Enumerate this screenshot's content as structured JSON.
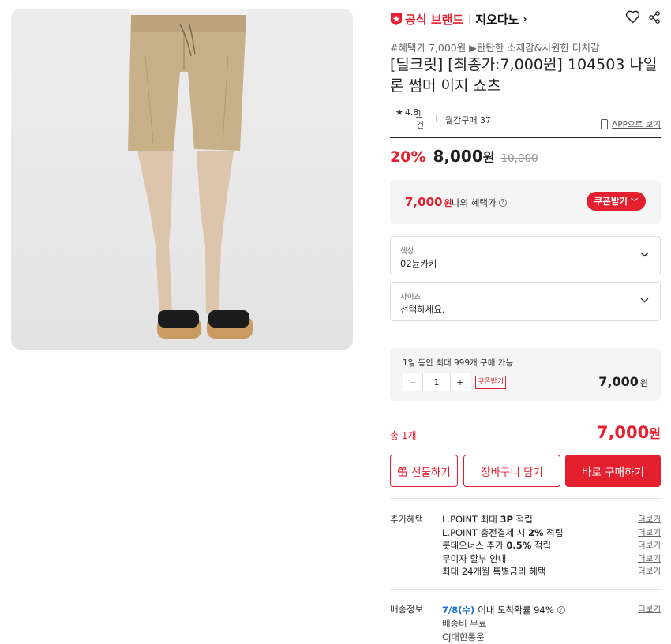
{
  "brand": {
    "official_label": "공식 브랜드",
    "name": "지오다노"
  },
  "product": {
    "tagline": "#혜택가 7,000원 ▶탄탄한 소재감&시원한 터치감",
    "title": "[딜크릿] [최종가:7,000원] 104503 나일론 썸머 이지 쇼츠",
    "rating": "4.8",
    "review_count": "4건",
    "monthly_sales": "월간구매 37",
    "app_link": "APP으로 보기"
  },
  "pricing": {
    "discount": "20%",
    "price": "8,000",
    "won": "원",
    "original_price": "10,000",
    "benefit_price": "7,000",
    "benefit_won": "원",
    "benefit_label": "나의 혜택가",
    "coupon_button": "쿠폰받기"
  },
  "options": {
    "color_label": "색상",
    "color_value": "02듄카키",
    "size_label": "사이즈",
    "size_value": "선택하세요."
  },
  "quantity": {
    "limit_text": "1일 동안 최대 999개 구매 가능",
    "value": "1",
    "coupon_tag": "쿠폰받기",
    "line_price": "7,000",
    "won": "원"
  },
  "total": {
    "label": "총 1개",
    "price": "7,000",
    "won": "원"
  },
  "actions": {
    "gift": "선물하기",
    "cart": "장바구니 담기",
    "buy": "바로 구매하기"
  },
  "benefits": {
    "title": "추가혜택",
    "more": "더보기",
    "items": [
      {
        "pre": "L.POINT 최대 ",
        "bold": "3P",
        "post": " 적립"
      },
      {
        "pre": "L.POINT 충전결제 시 ",
        "bold": "2%",
        "post": " 적립"
      },
      {
        "pre": "롯데오너스 추가 ",
        "bold": "0.5%",
        "post": " 적립"
      },
      {
        "pre": "무이자 할부 안내",
        "bold": "",
        "post": ""
      },
      {
        "pre": "최대 24개월 특별금리 혜택",
        "bold": "",
        "post": ""
      }
    ]
  },
  "shipping": {
    "title": "배송정보",
    "date": "7/8(수)",
    "arrival": "이내 도착확률 94%",
    "fee": "배송비 무료",
    "carrier": "CJ대한통운",
    "more": "더보기"
  },
  "colors": {
    "accent": "#e5202e",
    "link_blue": "#1f6fd6"
  }
}
